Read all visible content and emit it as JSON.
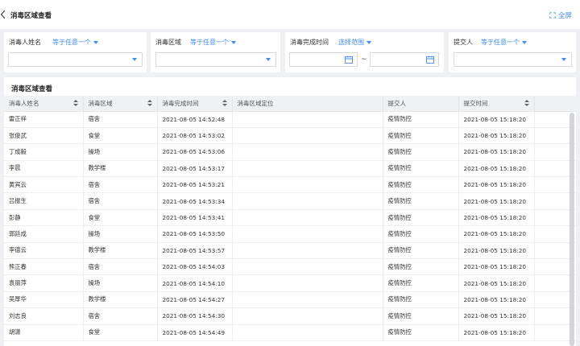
{
  "header": {
    "title": "消毒区域查看",
    "fullscreen_label": "全屏"
  },
  "filters": [
    {
      "label": "消毒人姓名",
      "operator": "等于任意一个",
      "type": "select"
    },
    {
      "label": "消毒区域",
      "operator": "等于任意一个",
      "type": "select"
    },
    {
      "label": "消毒完成时间",
      "operator": "选择范围",
      "type": "daterange",
      "separator": "~"
    },
    {
      "label": "提交人",
      "operator": "等于任意一个",
      "type": "select"
    }
  ],
  "table": {
    "title": "消毒区域查看",
    "columns": [
      "消毒人姓名",
      "消毒区域",
      "消毒完成时间",
      "消毒区域定位",
      "提交人",
      "提交时间"
    ],
    "rows": [
      [
        "雷正祥",
        "宿舍",
        "2021-08-05 14:52:48",
        "",
        "疫情防控",
        "2021-08-05 15:18:20"
      ],
      [
        "张俊武",
        "食堂",
        "2021-08-05 14:53:02",
        "",
        "疫情防控",
        "2021-08-05 15:18:20"
      ],
      [
        "丁成毅",
        "操场",
        "2021-08-05 14:53:06",
        "",
        "疫情防控",
        "2021-08-05 15:18:20"
      ],
      [
        "李晨",
        "教学楼",
        "2021-08-05 14:53:17",
        "",
        "疫情防控",
        "2021-08-05 15:18:20"
      ],
      [
        "黄宾云",
        "宿舍",
        "2021-08-05 14:53:21",
        "",
        "疫情防控",
        "2021-08-05 15:18:20"
      ],
      [
        "吕振生",
        "宿舍",
        "2021-08-05 14:53:34",
        "",
        "疫情防控",
        "2021-08-05 15:18:20"
      ],
      [
        "彭静",
        "食堂",
        "2021-08-05 14:53:41",
        "",
        "疫情防控",
        "2021-08-05 15:18:20"
      ],
      [
        "郭廷成",
        "操场",
        "2021-08-05 14:53:50",
        "",
        "疫情防控",
        "2021-08-05 15:18:20"
      ],
      [
        "李德云",
        "教学楼",
        "2021-08-05 14:53:57",
        "",
        "疫情防控",
        "2021-08-05 15:18:20"
      ],
      [
        "熊正春",
        "宿舍",
        "2021-08-05 14:54:03",
        "",
        "疫情防控",
        "2021-08-05 15:18:20"
      ],
      [
        "袁丽萍",
        "操场",
        "2021-08-05 14:54:10",
        "",
        "疫情防控",
        "2021-08-05 15:18:20"
      ],
      [
        "吴厚华",
        "教学楼",
        "2021-08-05 14:54:27",
        "",
        "疫情防控",
        "2021-08-05 15:18:20"
      ],
      [
        "刘志良",
        "宿舍",
        "2021-08-05 14:54:30",
        "",
        "疫情防控",
        "2021-08-05 15:18:20"
      ],
      [
        "胡潇",
        "食堂",
        "2021-08-05 14:54:49",
        "",
        "疫情防控",
        "2021-08-05 15:18:20"
      ]
    ],
    "sortable": [
      true,
      true,
      true,
      false,
      false,
      true
    ]
  },
  "colors": {
    "accent": "#3d8bfd",
    "header_bg": "#f0f1f3",
    "page_bg": "#eef0f3"
  }
}
